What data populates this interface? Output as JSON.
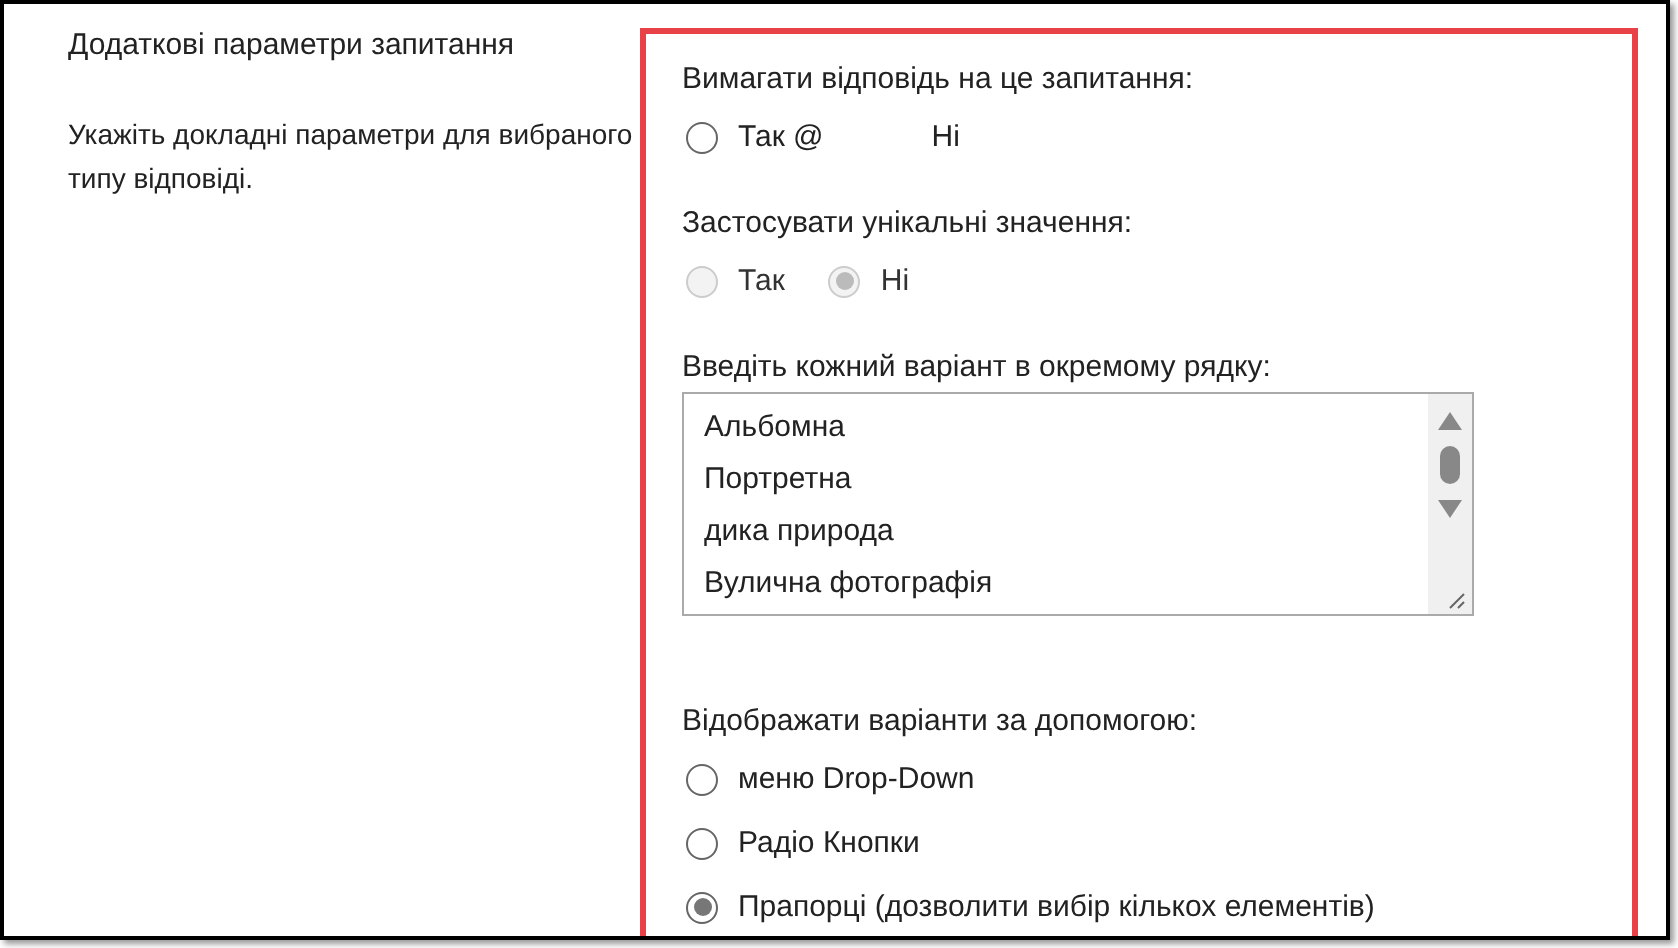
{
  "left": {
    "title": "Додаткові параметри запитання",
    "description": "Укажіть докладні параметри для вибраного типу відповіді."
  },
  "sections": [
    {
      "kind": "radios",
      "label": "Вимагати відповідь на це запитання:",
      "disabled": false,
      "options": [
        {
          "label": "Так @",
          "kind": "radio",
          "selected": false
        },
        {
          "label": "Ні",
          "kind": "plain"
        }
      ]
    },
    {
      "kind": "radios",
      "label": "Застосувати унікальні значення:",
      "disabled": true,
      "options": [
        {
          "label": "Так",
          "kind": "radio",
          "selected": false
        },
        {
          "label": "Ні",
          "kind": "radio",
          "selected": true
        }
      ]
    },
    {
      "kind": "textarea",
      "label": "Введіть кожний варіант в окремому рядку:",
      "lines": [
        "Альбомна",
        "Портретна",
        "дика природа",
        "Вулична фотографія"
      ]
    },
    {
      "kind": "radios-vertical",
      "label": "Відображати варіанти за допомогою:",
      "disabled": false,
      "options": [
        {
          "label": "меню Drop-Down",
          "kind": "radio",
          "selected": false
        },
        {
          "label": "Радіо Кнопки",
          "kind": "radio",
          "selected": false
        },
        {
          "label": "Прапорці (дозволити вибір кількох елементів)",
          "kind": "radio",
          "selected": true
        }
      ]
    }
  ]
}
